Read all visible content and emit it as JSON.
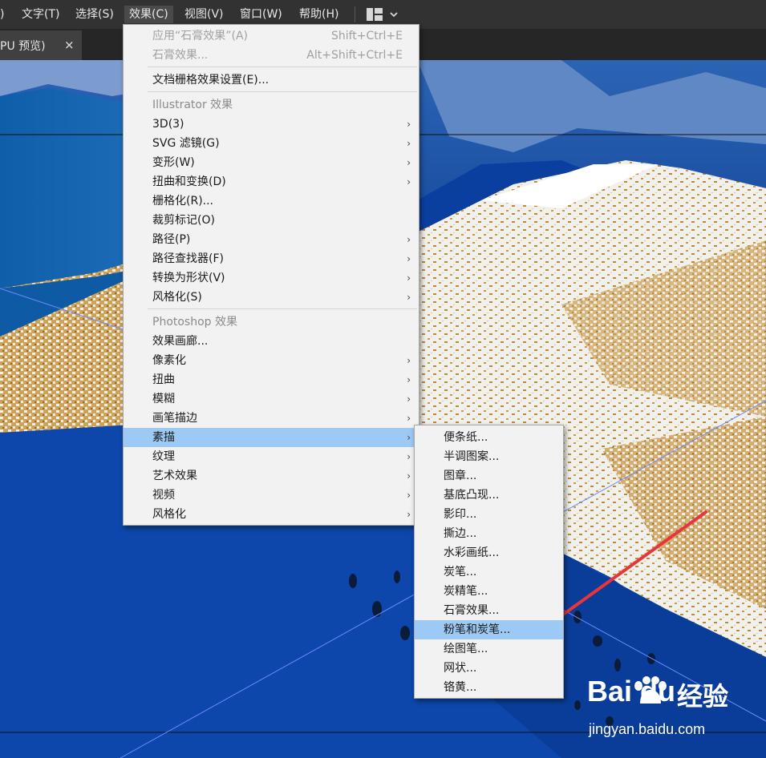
{
  "menubar": {
    "items": [
      {
        "label": ")"
      },
      {
        "label": "文字(T)"
      },
      {
        "label": "选择(S)"
      },
      {
        "label": "效果(C)"
      },
      {
        "label": "视图(V)"
      },
      {
        "label": "窗口(W)"
      },
      {
        "label": "帮助(H)"
      }
    ],
    "layout_icon": "workspace-layout-icon"
  },
  "document_tab": {
    "label": "PU 预览)",
    "close": "×"
  },
  "effect_menu": {
    "items": [
      {
        "label": "应用“石膏效果”(A)",
        "shortcut": "Shift+Ctrl+E",
        "disabled": true
      },
      {
        "label": "石膏效果...",
        "shortcut": "Alt+Shift+Ctrl+E",
        "disabled": true
      },
      {
        "label": "文档栅格效果设置(E)..."
      },
      {
        "label": "Illustrator 效果",
        "header": true
      },
      {
        "label": "3D(3)",
        "submenu": true
      },
      {
        "label": "SVG 滤镜(G)",
        "submenu": true
      },
      {
        "label": "变形(W)",
        "submenu": true
      },
      {
        "label": "扭曲和变换(D)",
        "submenu": true
      },
      {
        "label": "栅格化(R)..."
      },
      {
        "label": "裁剪标记(O)"
      },
      {
        "label": "路径(P)",
        "submenu": true
      },
      {
        "label": "路径查找器(F)",
        "submenu": true
      },
      {
        "label": "转换为形状(V)",
        "submenu": true
      },
      {
        "label": "风格化(S)",
        "submenu": true
      },
      {
        "label": "Photoshop 效果",
        "header": true
      },
      {
        "label": "效果画廊..."
      },
      {
        "label": "像素化",
        "submenu": true
      },
      {
        "label": "扭曲",
        "submenu": true
      },
      {
        "label": "模糊",
        "submenu": true
      },
      {
        "label": "画笔描边",
        "submenu": true
      },
      {
        "label": "素描",
        "submenu": true,
        "highlighted": true
      },
      {
        "label": "纹理",
        "submenu": true
      },
      {
        "label": "艺术效果",
        "submenu": true
      },
      {
        "label": "视频",
        "submenu": true
      },
      {
        "label": "风格化",
        "submenu": true
      }
    ],
    "submenu_arrow": "›"
  },
  "sketch_submenu": {
    "items": [
      {
        "label": "便条纸..."
      },
      {
        "label": "半调图案..."
      },
      {
        "label": "图章..."
      },
      {
        "label": "基底凸现..."
      },
      {
        "label": "影印..."
      },
      {
        "label": "撕边..."
      },
      {
        "label": "水彩画纸..."
      },
      {
        "label": "炭笔..."
      },
      {
        "label": "炭精笔..."
      },
      {
        "label": "石膏效果..."
      },
      {
        "label": "粉笔和炭笔...",
        "highlighted": true
      },
      {
        "label": "绘图笔..."
      },
      {
        "label": "网状..."
      },
      {
        "label": "铬黄..."
      }
    ]
  },
  "annotation": {
    "arrow_color": "#e8353a"
  },
  "watermark": {
    "logo": "Bai du",
    "brand": "经验",
    "url": "jingyan.baidu.com"
  },
  "colors": {
    "menubar_bg": "#323232",
    "menu_bg": "#f2f2f2",
    "menu_highlight": "#9ccaf4",
    "canvas_blue": "#0c43a6"
  }
}
